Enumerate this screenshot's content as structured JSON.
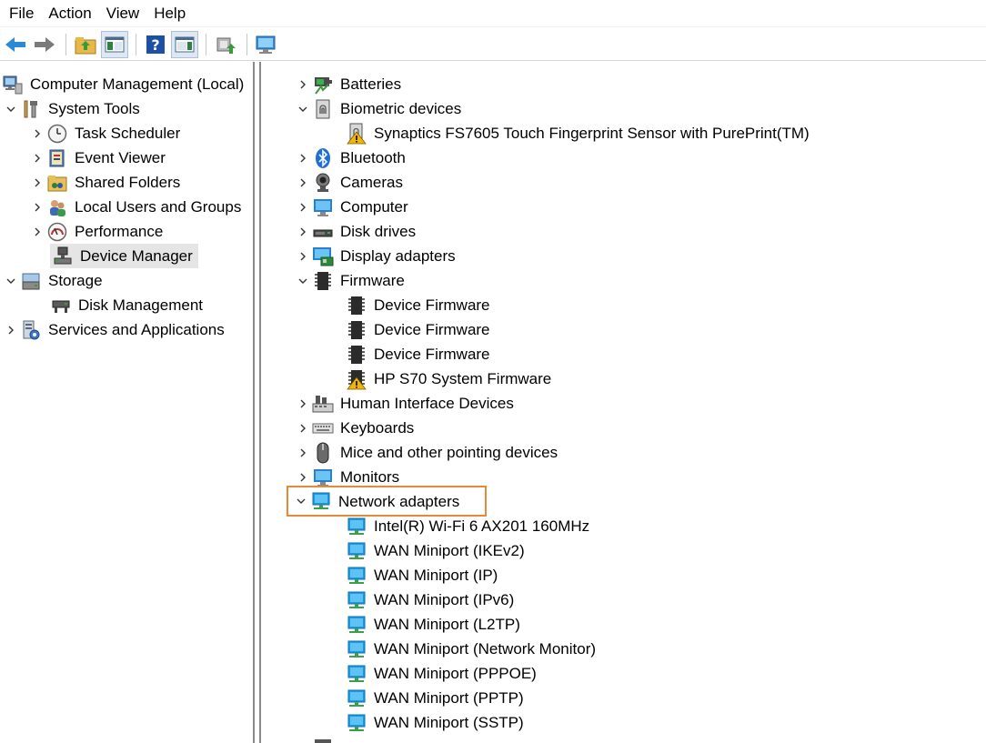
{
  "menu": {
    "file": "File",
    "action": "Action",
    "view": "View",
    "help": "Help"
  },
  "tree": {
    "root": "Computer Management (Local)",
    "system_tools": "System Tools",
    "task_scheduler": "Task Scheduler",
    "event_viewer": "Event Viewer",
    "shared_folders": "Shared Folders",
    "local_users_groups": "Local Users and Groups",
    "performance": "Performance",
    "device_manager": "Device Manager",
    "storage": "Storage",
    "disk_management": "Disk Management",
    "services_apps": "Services and Applications"
  },
  "devices": {
    "batteries": "Batteries",
    "biometric": "Biometric devices",
    "fingerprint": "Synaptics FS7605 Touch Fingerprint Sensor with PurePrint(TM)",
    "bluetooth": "Bluetooth",
    "cameras": "Cameras",
    "computer": "Computer",
    "disk_drives": "Disk drives",
    "display_adapters": "Display adapters",
    "firmware": "Firmware",
    "fw1": "Device Firmware",
    "fw2": "Device Firmware",
    "fw3": "Device Firmware",
    "fw4": "HP S70 System Firmware",
    "hid": "Human Interface Devices",
    "keyboards": "Keyboards",
    "mice": "Mice and other pointing devices",
    "monitors": "Monitors",
    "network_adapters": "Network adapters",
    "net1": "Intel(R) Wi-Fi 6 AX201 160MHz",
    "net2": "WAN Miniport (IKEv2)",
    "net3": "WAN Miniport (IP)",
    "net4": "WAN Miniport (IPv6)",
    "net5": "WAN Miniport (L2TP)",
    "net6": "WAN Miniport (Network Monitor)",
    "net7": "WAN Miniport (PPPOE)",
    "net8": "WAN Miniport (PPTP)",
    "net9": "WAN Miniport (SSTP)"
  },
  "colors": {
    "highlight": "#e8893a",
    "selected": "#e5e5e5",
    "network_icon": "#1e9be0",
    "warning": "#f2b705"
  }
}
